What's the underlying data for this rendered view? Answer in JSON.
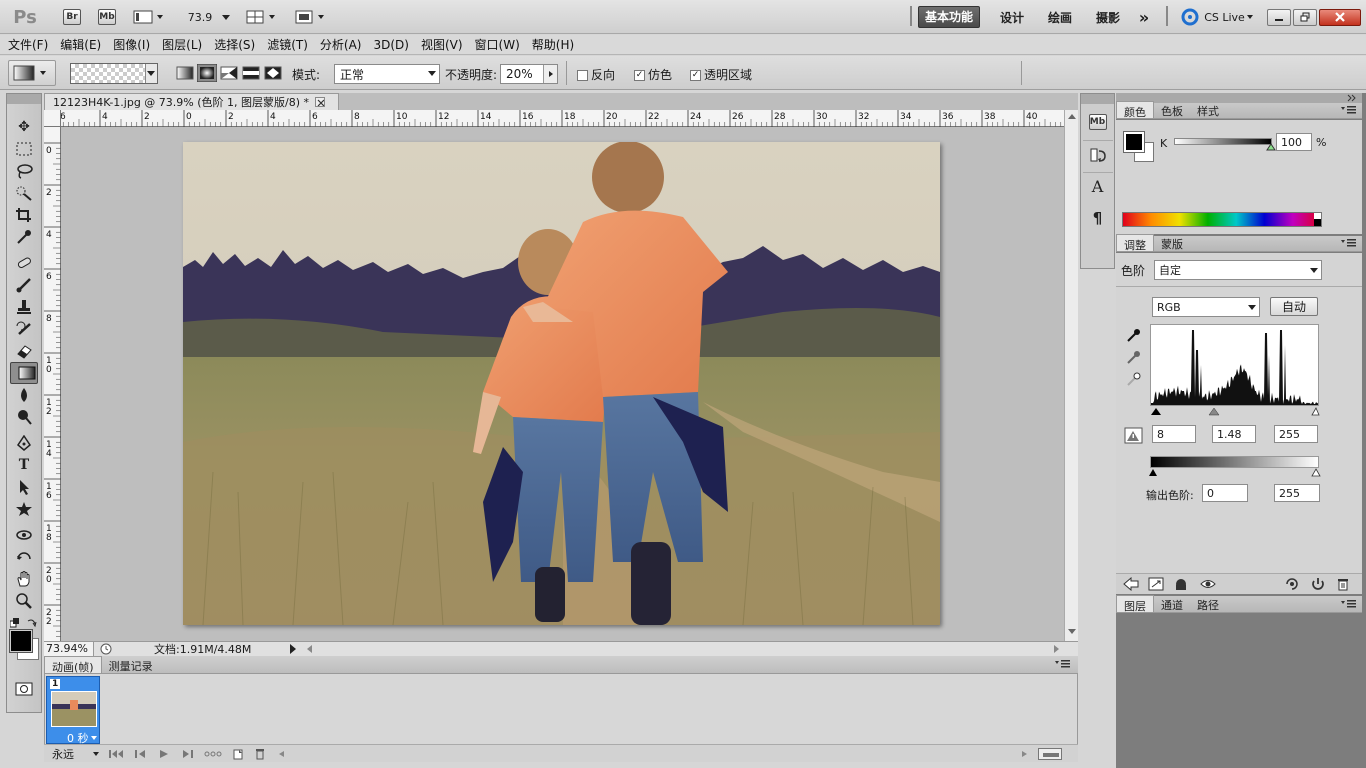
{
  "app": {
    "logo": "Ps",
    "bridge": "Br",
    "minibridge": "Mb",
    "zoom": "73.9",
    "workspaces": [
      "基本功能",
      "设计",
      "绘画",
      "摄影"
    ],
    "more": "»",
    "cslive": "CS Live"
  },
  "menu": [
    "文件(F)",
    "编辑(E)",
    "图像(I)",
    "图层(L)",
    "选择(S)",
    "滤镜(T)",
    "分析(A)",
    "3D(D)",
    "视图(V)",
    "窗口(W)",
    "帮助(H)"
  ],
  "options": {
    "mode_label": "模式:",
    "mode_value": "正常",
    "opacity_label": "不透明度:",
    "opacity_value": "20%",
    "reverse": "反向",
    "dither": "仿色",
    "transparency": "透明区域"
  },
  "document": {
    "tab": "12123H4K-1.jpg @ 73.9% (色阶 1, 图层蒙版/8) *",
    "ruler_h": [
      "6",
      "4",
      "2",
      "0",
      "2",
      "4",
      "6",
      "8",
      "10",
      "12",
      "14",
      "16",
      "18",
      "20",
      "22",
      "24",
      "26",
      "28",
      "30",
      "32",
      "34",
      "36",
      "38",
      "40"
    ],
    "ruler_v": [
      "0",
      "2",
      "4",
      "6",
      "8",
      "1\n0",
      "1\n2",
      "1\n4",
      "1\n6",
      "1\n8",
      "2\n0",
      "2\n2"
    ],
    "status_zoom": "73.94%",
    "status_doc": "文档:1.91M/4.48M"
  },
  "animation": {
    "tab1": "动画(帧)",
    "tab2": "测量记录",
    "frame_num": "1",
    "frame_delay": "0 秒",
    "loop": "永远"
  },
  "color_panel": {
    "tabs": [
      "颜色",
      "色板",
      "样式"
    ],
    "channel": "K",
    "value": "100",
    "unit": "%"
  },
  "adjust_panel": {
    "tabs": [
      "调整",
      "蒙版"
    ],
    "preset_label": "色阶",
    "preset_value": "自定",
    "channel_value": "RGB",
    "auto": "自动",
    "input_black": "8",
    "input_gamma": "1.48",
    "input_white": "255",
    "output_label": "输出色阶:",
    "output_black": "0",
    "output_white": "255"
  },
  "layers_panel": {
    "tabs": [
      "图层",
      "通道",
      "路径"
    ]
  }
}
